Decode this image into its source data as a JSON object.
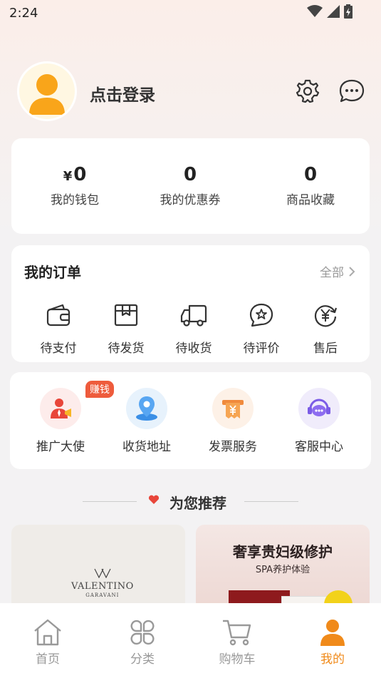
{
  "status": {
    "time": "2:24"
  },
  "profile": {
    "login_text": "点击登录"
  },
  "assets": [
    {
      "currency": "¥",
      "value": "0",
      "label": "我的钱包"
    },
    {
      "currency": "",
      "value": "0",
      "label": "我的优惠券"
    },
    {
      "currency": "",
      "value": "0",
      "label": "商品收藏"
    }
  ],
  "orders": {
    "title": "我的订单",
    "all_label": "全部",
    "items": [
      {
        "label": "待支付",
        "icon": "wallet-icon"
      },
      {
        "label": "待发货",
        "icon": "package-icon"
      },
      {
        "label": "待收货",
        "icon": "truck-icon"
      },
      {
        "label": "待评价",
        "icon": "star-bubble-icon"
      },
      {
        "label": "售后",
        "icon": "yen-refresh-icon"
      }
    ]
  },
  "services": {
    "badge": "赚钱",
    "items": [
      {
        "label": "推广大使",
        "icon": "ambassador-icon"
      },
      {
        "label": "收货地址",
        "icon": "location-icon"
      },
      {
        "label": "发票服务",
        "icon": "invoice-icon"
      },
      {
        "label": "客服中心",
        "icon": "customer-service-icon"
      }
    ]
  },
  "recommend": {
    "title": "为您推荐"
  },
  "products": [
    {
      "brand": "VALENTINO",
      "brand_sub": "GARAVANI"
    },
    {
      "title": "奢享贵妇级修护",
      "subtitle": "SPA养护体验"
    }
  ],
  "tabbar": [
    {
      "label": "首页",
      "icon": "home-icon",
      "active": false
    },
    {
      "label": "分类",
      "icon": "category-icon",
      "active": false
    },
    {
      "label": "购物车",
      "icon": "cart-icon",
      "active": false
    },
    {
      "label": "我的",
      "icon": "user-icon",
      "active": true
    }
  ],
  "colors": {
    "accent": "#f08a1a",
    "badge": "#ee5b3c"
  }
}
